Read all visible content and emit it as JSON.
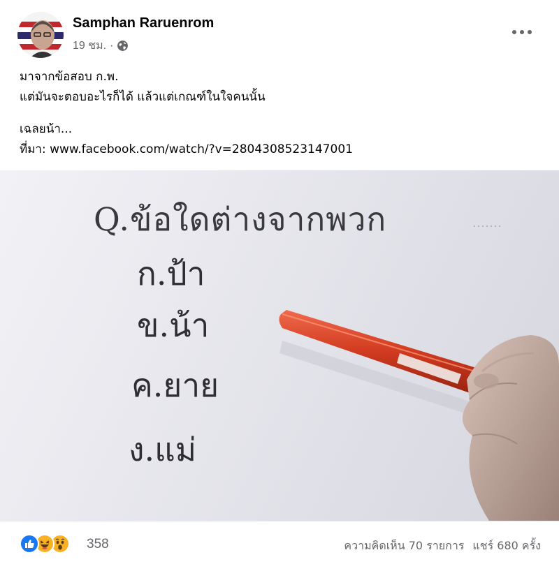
{
  "post": {
    "author": "Samphan Raruenrom",
    "timestamp": "19 ชม.",
    "separator": "·",
    "privacy_icon": "globe-icon",
    "more_icon": "more-options-icon",
    "text_lines": [
      "มาจากข้อสอบ ก.พ.",
      "แต่มันจะตอบอะไรก็ได้ แล้วแต่เกณฑ์ในใจคนนั้น"
    ],
    "answer_line": "เฉลยน้า...",
    "source_prefix": "ที่มา: ",
    "source_link": "www.facebook.com/watch/?v=2804308523147001"
  },
  "media": {
    "question": "Q.ข้อใดต่างจากพวก",
    "choices": [
      "ก.ป้า",
      "ข.น้า",
      "ค.ยาย",
      "ง.แม่"
    ],
    "pen_color": "#d13b1f"
  },
  "footer": {
    "reactions": [
      "like-icon",
      "haha-icon",
      "wow-icon"
    ],
    "reaction_count": "358",
    "comments": "ความคิดเห็น 70 รายการ",
    "shares": "แชร์ 680 ครั้ง"
  },
  "colors": {
    "like": "#1877f2",
    "haha": "#f7b125",
    "secondary_text": "#65676b"
  }
}
